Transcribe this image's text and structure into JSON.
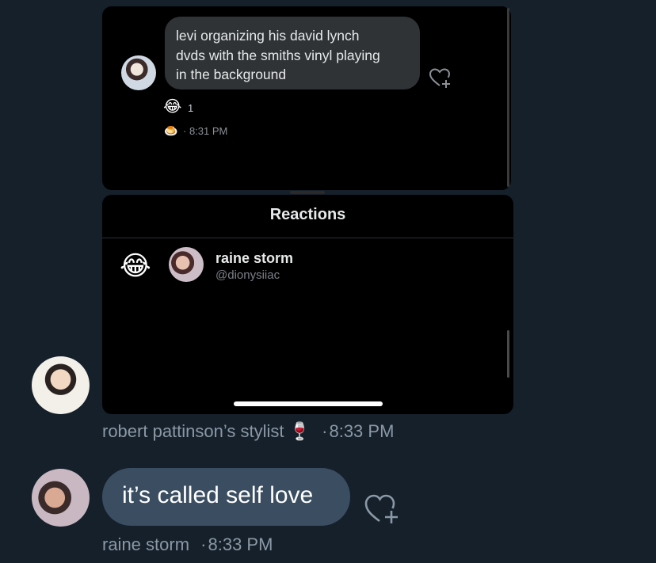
{
  "embedded_screenshot": {
    "message": {
      "text": "levi organizing his david lynch\ndvds with the smiths vinyl playing\nin the background",
      "reaction_emoji": "😂",
      "reaction_count": "1",
      "small_emoji": "🍮",
      "time": "· 8:31 PM"
    },
    "reactions_sheet": {
      "title": "Reactions",
      "items": [
        {
          "emoji": "😂",
          "name": "raine storm",
          "handle": "@dionysiiac"
        }
      ]
    }
  },
  "thread": {
    "message_1_meta": {
      "sender": "robert pattinson’s stylist",
      "emoji": "🍷",
      "time": "8:33 PM"
    },
    "message_2": {
      "text": "it’s called self love"
    },
    "message_2_meta": {
      "sender": "raine storm",
      "time": "8:33 PM"
    }
  },
  "colors": {
    "background": "#15202b",
    "bubble": "#3b4d61",
    "meta_text": "#8b98a5"
  },
  "icons": [
    "heart-add-icon",
    "avatar"
  ]
}
